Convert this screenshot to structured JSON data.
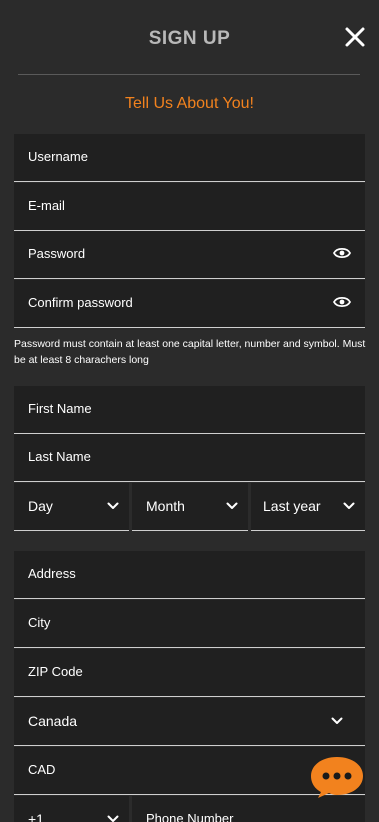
{
  "header": {
    "title": "SIGN UP"
  },
  "subtitle": "Tell Us About You!",
  "account": {
    "username": "Username",
    "email": "E-mail",
    "password": "Password",
    "confirm_password": "Confirm password"
  },
  "password_hint": "Password must contain at least one capital letter, number and symbol. Must be at least 8 charachers long",
  "personal": {
    "first_name": "First Name",
    "last_name": "Last Name",
    "day": "Day",
    "month": "Month",
    "year": "Last year"
  },
  "address": {
    "address": "Address",
    "city": "City",
    "zip": "ZIP Code",
    "country": "Canada",
    "currency": "CAD",
    "phone_code": "+1",
    "phone_number": "Phone Number"
  },
  "colors": {
    "accent": "#f2821e",
    "background": "#2b2b2b",
    "field": "#202020"
  }
}
